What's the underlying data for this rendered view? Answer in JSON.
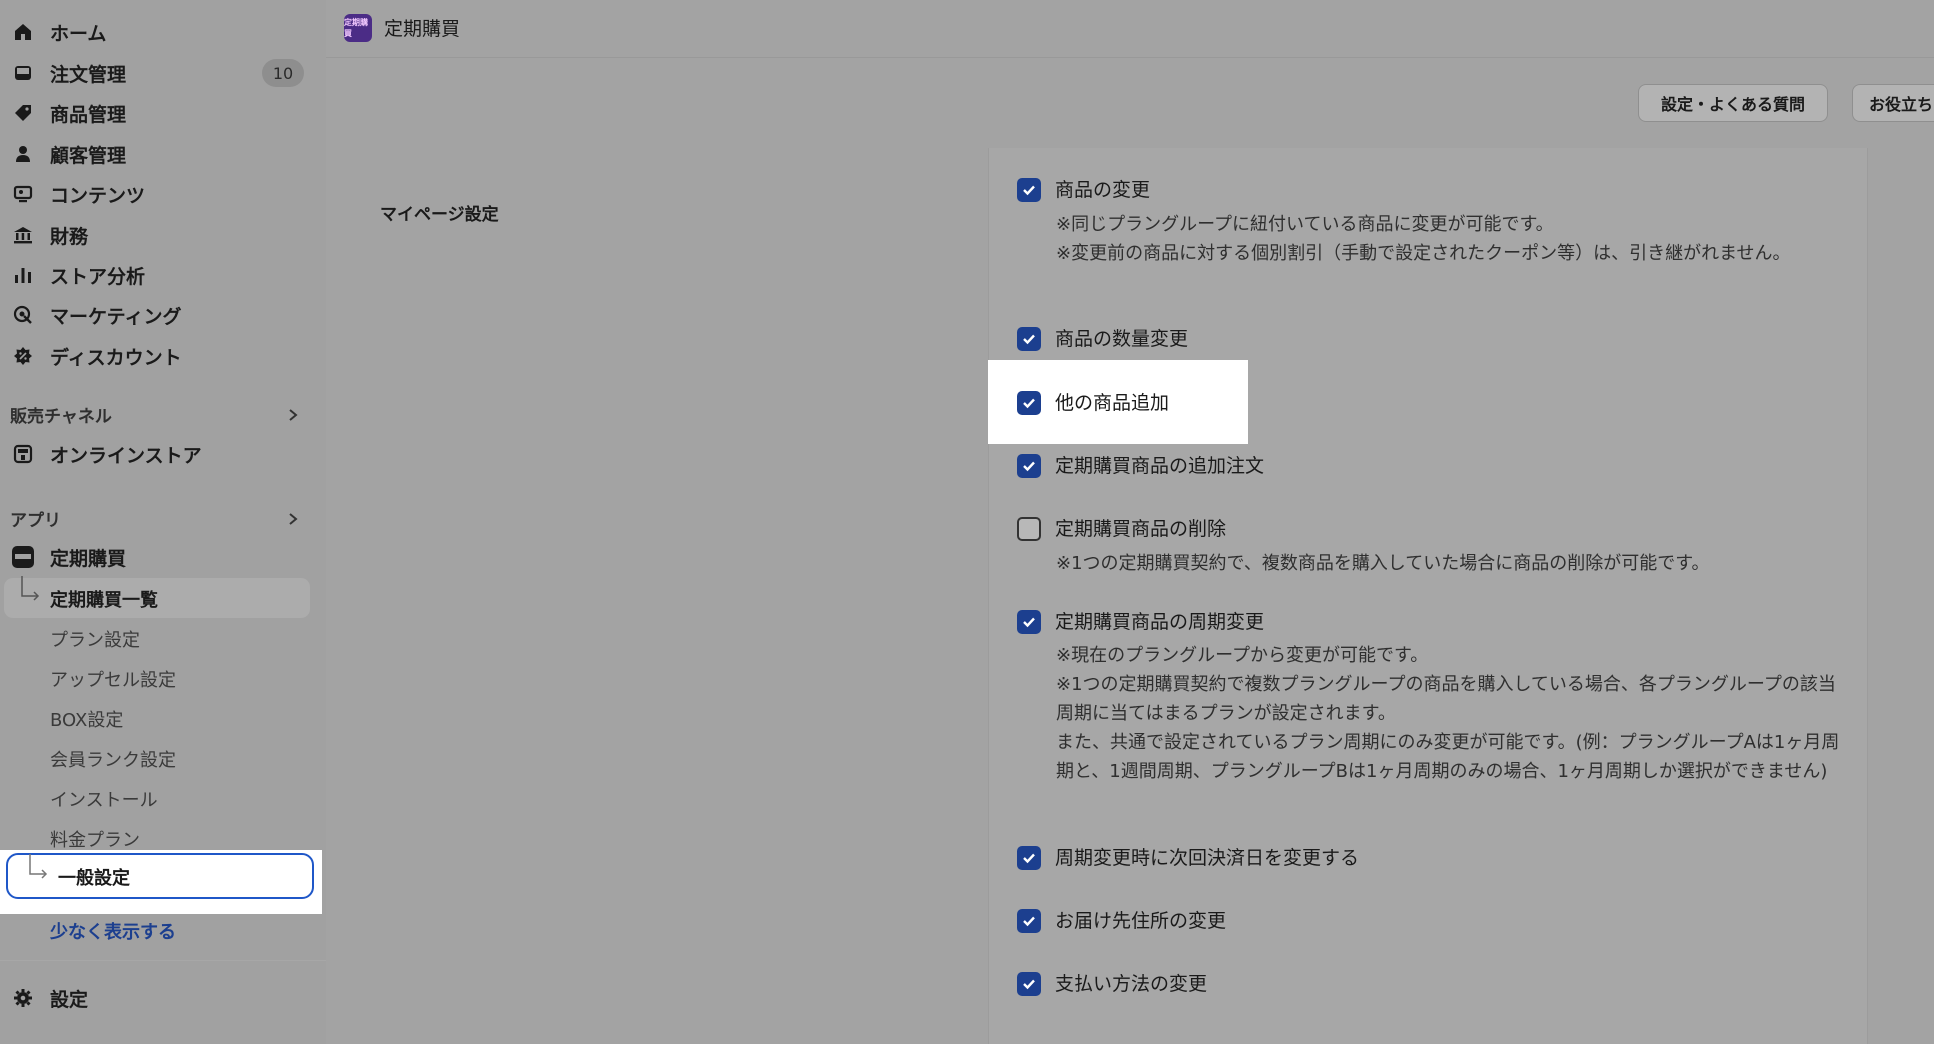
{
  "sidebar": {
    "nav": [
      {
        "label": "ホーム",
        "icon": "home-icon"
      },
      {
        "label": "注文管理",
        "icon": "inbox-icon",
        "badge": "10"
      },
      {
        "label": "商品管理",
        "icon": "tag-icon"
      },
      {
        "label": "顧客管理",
        "icon": "person-icon"
      },
      {
        "label": "コンテンツ",
        "icon": "content-icon"
      },
      {
        "label": "財務",
        "icon": "bank-icon"
      },
      {
        "label": "ストア分析",
        "icon": "bar-chart-icon"
      },
      {
        "label": "マーケティング",
        "icon": "target-icon"
      },
      {
        "label": "ディスカウント",
        "icon": "discount-icon"
      }
    ],
    "sales_channels_label": "販売チャネル",
    "online_store_label": "オンラインストア",
    "apps_label": "アプリ",
    "app_name": "定期購買",
    "app_subitems": [
      "定期購買一覧",
      "プラン設定",
      "アップセル設定",
      "BOX設定",
      "会員ランク設定",
      "インストール",
      "料金プラン",
      "一般設定"
    ],
    "show_less": "少なく表示する",
    "settings_label": "設定"
  },
  "topbar": {
    "app_logo_text": "定期購買",
    "title": "定期購買"
  },
  "actions": {
    "faq_button": "設定・よくある質問",
    "help_button": "お役立ち"
  },
  "section": {
    "title": "マイページ設定"
  },
  "options": [
    {
      "label": "商品の変更",
      "checked": true,
      "notes": [
        "※同じプラングループに紐付いている商品に変更が可能です。",
        "※変更前の商品に対する個別割引（手動で設定されたクーポン等）は、引き継がれません。"
      ]
    },
    {
      "label": "商品の数量変更",
      "checked": true,
      "notes": []
    },
    {
      "label": "他の商品追加",
      "checked": true,
      "notes": []
    },
    {
      "label": "定期購買商品の追加注文",
      "checked": true,
      "notes": []
    },
    {
      "label": "定期購買商品の削除",
      "checked": false,
      "notes": [
        "※1つの定期購買契約で、複数商品を購入していた場合に商品の削除が可能です。"
      ]
    },
    {
      "label": "定期購買商品の周期変更",
      "checked": true,
      "notes": [
        "※現在のプラングループから変更が可能です。",
        "※1つの定期購買契約で複数プラングループの商品を購入している場合、各プラングループの該当周期に当てはまるプランが設定されます。",
        "また、共通で設定されているプラン周期にのみ変更が可能です。(例：プラングループAは1ヶ月周期と、1週間周期、プラングループBは1ヶ月周期のみの場合、1ヶ月周期しか選択ができません)"
      ]
    },
    {
      "label": "周期変更時に次回決済日を変更する",
      "checked": true,
      "notes": []
    },
    {
      "label": "お届け先住所の変更",
      "checked": true,
      "notes": []
    },
    {
      "label": "支払い方法の変更",
      "checked": true,
      "notes": []
    }
  ],
  "colors": {
    "checkbox_checked": "#1c3f8f",
    "focus_ring": "#1f57c8",
    "app_logo": "#4b2c86"
  }
}
